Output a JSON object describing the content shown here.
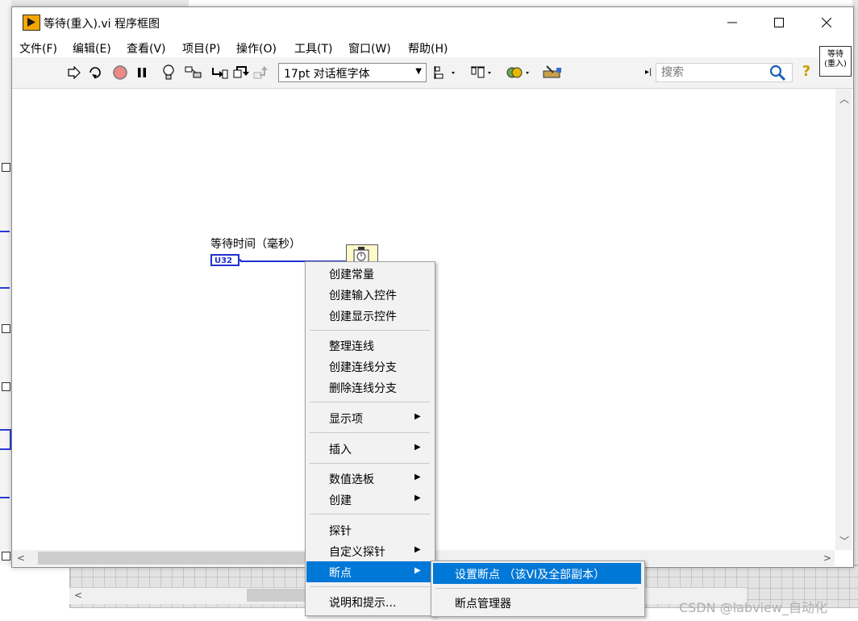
{
  "window": {
    "title": "等待(重入).vi 程序框图",
    "minimize": "—",
    "maximize": "☐",
    "close": "✕"
  },
  "menubar": [
    "文件(F)",
    "编辑(E)",
    "查看(V)",
    "项目(P)",
    "操作(O)",
    "工具(T)",
    "窗口(W)",
    "帮助(H)"
  ],
  "toolbar": {
    "font": "17pt 对话框字体",
    "search_placeholder": "搜索",
    "help": "?"
  },
  "corner_icon": {
    "line1": "等待",
    "line2": "(重入)"
  },
  "diagram": {
    "control_label": "等待时间（毫秒）",
    "terminal_type": "U32"
  },
  "context_menu": {
    "items": [
      "创建常量",
      "创建输入控件",
      "创建显示控件",
      "整理连线",
      "创建连线分支",
      "删除连线分支",
      "显示项",
      "插入",
      "数值选板",
      "创建",
      "探针",
      "自定义探针",
      "断点",
      "说明和提示..."
    ],
    "submenu_arrow": "▶",
    "highlighted": "断点"
  },
  "submenu": {
    "items": [
      "设置断点 （该VI及全部副本）",
      "断点管理器"
    ],
    "highlighted": "设置断点 （该VI及全部副本）"
  },
  "colors": {
    "accent": "#0078d7",
    "wire": "#2030d0",
    "title_icon": "#f5a700"
  },
  "watermark": "CSDN @labview_自动化"
}
